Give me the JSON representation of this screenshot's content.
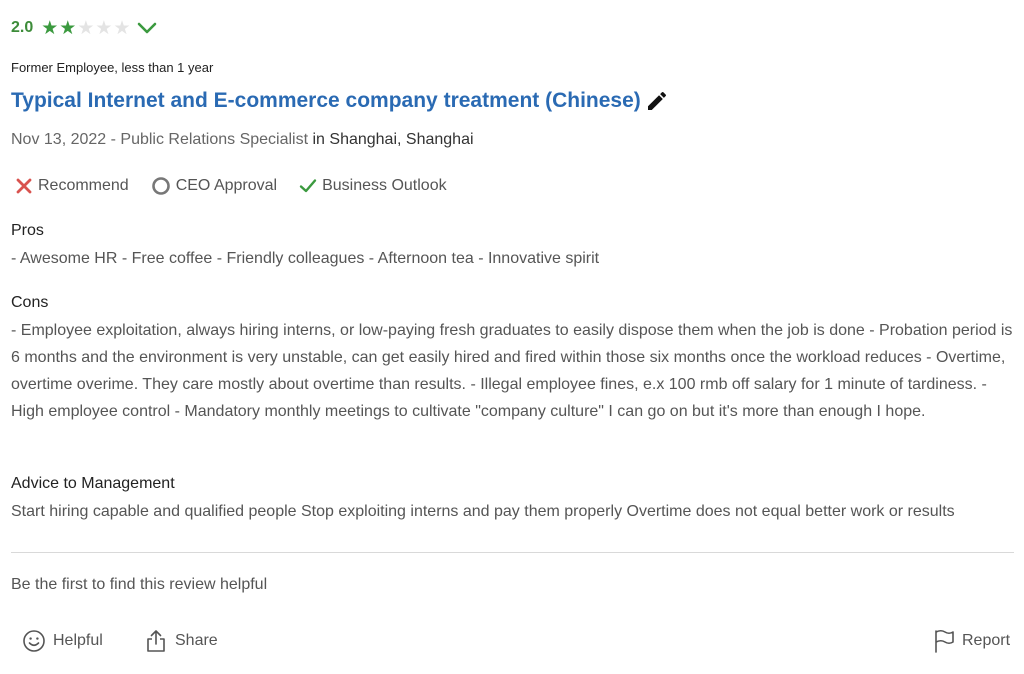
{
  "rating": {
    "value_text": "2.0",
    "value": 2,
    "max": 5,
    "star_color": "#3b9a3f",
    "empty_star_color": "#e4e4e4",
    "chevron_icon": "chevron-down-icon"
  },
  "review": {
    "employee_status": "Former Employee, less than 1 year",
    "title": "Typical Internet and E-commerce company treatment (Chinese)",
    "title_color": "#2a6ab3",
    "edit_icon": "pencil-icon",
    "date_role": "Nov 13, 2022 - Public Relations Specialist",
    "in_word": " in ",
    "location": "Shanghai, Shanghai"
  },
  "indicators": [
    {
      "label": "Recommend",
      "icon": "x-icon",
      "color": "#d9534f"
    },
    {
      "label": "CEO Approval",
      "icon": "circle-icon",
      "color": "#777777"
    },
    {
      "label": "Business Outlook",
      "icon": "check-icon",
      "color": "#3b9a3f"
    }
  ],
  "pros": {
    "heading": "Pros",
    "text": "- Awesome HR - Free coffee - Friendly colleagues - Afternoon tea - Innovative spirit"
  },
  "cons": {
    "heading": "Cons",
    "text": "- Employee exploitation, always hiring interns, or low-paying fresh graduates to easily dispose them when the job is done - Probation period is 6 months and the environment is very unstable, can get easily hired and fired within those six months once the workload reduces - Overtime, overtime overime. They care mostly about overtime than results. - Illegal employee fines, e.x 100 rmb off salary for 1 minute of tardiness. - High employee control - Mandatory monthly meetings to cultivate \"company culture\" I can go on but it's more than enough I hope."
  },
  "advice": {
    "heading": "Advice to Management",
    "text": "Start hiring capable and qualified people Stop exploiting interns and pay them properly Overtime does not equal better work or results"
  },
  "footer": {
    "helpful_prompt": "Be the first to find this review helpful",
    "helpful_label": "Helpful",
    "helpful_icon": "smiley-icon",
    "share_label": "Share",
    "share_icon": "share-icon",
    "report_label": "Report",
    "report_icon": "flag-icon"
  }
}
